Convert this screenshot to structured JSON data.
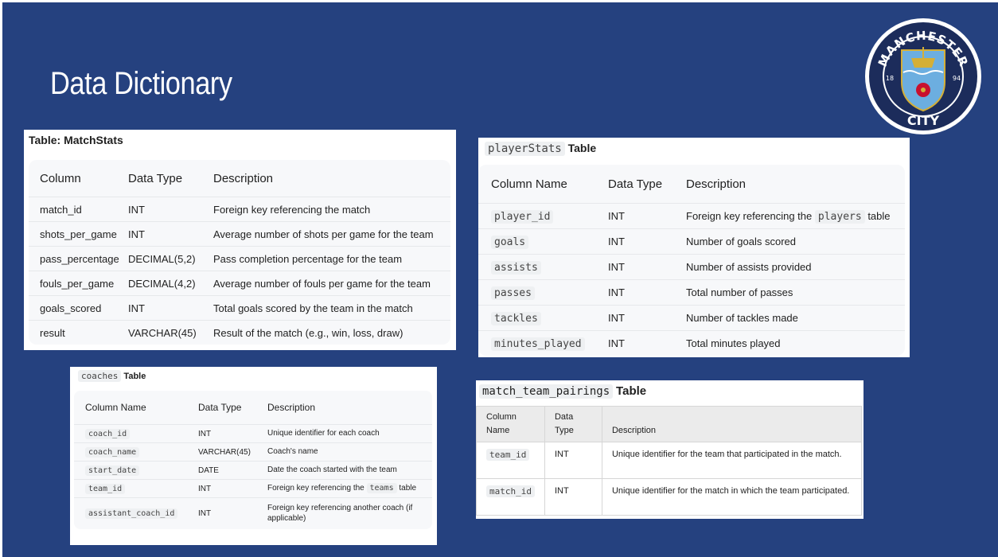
{
  "slide": {
    "title": "Data Dictionary"
  },
  "logo": {
    "top_text": "MANCHESTER",
    "bottom_text": "CITY",
    "left_year": "18",
    "right_year": "94"
  },
  "match_stats": {
    "caption": "Table: MatchStats",
    "headers": [
      "Column",
      "Data Type",
      "Description"
    ],
    "rows": [
      [
        "match_id",
        "INT",
        "Foreign key referencing the match"
      ],
      [
        "shots_per_game",
        "INT",
        "Average number of shots per game for the team"
      ],
      [
        "pass_percentage",
        "DECIMAL(5,2)",
        "Pass completion percentage for the team"
      ],
      [
        "fouls_per_game",
        "DECIMAL(4,2)",
        "Average number of fouls per game for the team"
      ],
      [
        "goals_scored",
        "INT",
        "Total goals scored by the team in the match"
      ],
      [
        "result",
        "VARCHAR(45)",
        "Result of the match (e.g., win, loss, draw)"
      ]
    ]
  },
  "player_stats": {
    "caption_code": "playerStats",
    "caption_word": "Table",
    "headers": [
      "Column Name",
      "Data Type",
      "Description"
    ],
    "rows": [
      [
        "player_id",
        "INT",
        "Foreign key referencing the",
        "players",
        "table"
      ],
      [
        "goals",
        "INT",
        "Number of goals scored"
      ],
      [
        "assists",
        "INT",
        "Number of assists provided"
      ],
      [
        "passes",
        "INT",
        "Total number of passes"
      ],
      [
        "tackles",
        "INT",
        "Number of tackles made"
      ],
      [
        "minutes_played",
        "INT",
        "Total minutes played"
      ]
    ]
  },
  "coaches": {
    "caption_code": "coaches",
    "caption_word": "Table",
    "headers": [
      "Column Name",
      "Data Type",
      "Description"
    ],
    "rows": [
      [
        "coach_id",
        "INT",
        "Unique identifier for each coach"
      ],
      [
        "coach_name",
        "VARCHAR(45)",
        "Coach's name"
      ],
      [
        "start_date",
        "DATE",
        "Date the coach started with the team"
      ],
      [
        "team_id",
        "INT",
        "Foreign key referencing the",
        "teams",
        "table"
      ],
      [
        "assistant_coach_id",
        "INT",
        "Foreign key referencing another coach (if applicable)"
      ]
    ]
  },
  "pairings": {
    "caption_code": "match_team_pairings",
    "caption_word": "Table",
    "headers": [
      "Column Name",
      "Data Type",
      "Description"
    ],
    "rows": [
      [
        "team_id",
        "INT",
        "Unique identifier for the team that participated in the match."
      ],
      [
        "match_id",
        "INT",
        "Unique identifier for the match in which the team participated."
      ]
    ]
  }
}
